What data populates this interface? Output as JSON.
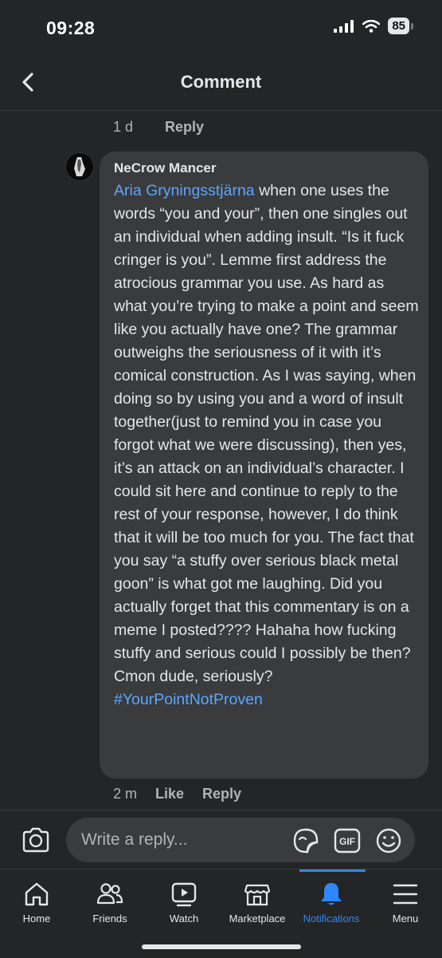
{
  "status_bar": {
    "time": "09:28",
    "battery": "85"
  },
  "header": {
    "title": "Comment"
  },
  "previous_comment": {
    "time": "1 d",
    "reply_label": "Reply"
  },
  "comment": {
    "author": "NeCrow Mancer",
    "mention": "Aria Gryningsstjärna",
    "body": " when one uses the words “you and your”, then one singles out an individual when adding insult. “Is it fuck cringer is you”. Lemme first address the atrocious grammar you use. As hard as what you’re trying to make a point and seem like you actually have one? The grammar outweighs the seriousness of it with it’s comical construction. As I was saying, when doing so by using you and a word of insult together(just to remind you in case you forgot what we were discussing), then yes, it’s an attack on an individual’s character. I could sit here and continue to reply to the rest of your response, however, I do think that it will be too much for you. The fact that you say “a stuffy over serious black metal goon” is what got me laughing. Did you actually forget that this commentary is on a meme I posted???? Hahaha how fucking stuffy and serious could I possibly be then? Cmon dude, seriously? ",
    "hashtag": "#YourPointNotProven",
    "time": "2 m",
    "like_label": "Like",
    "reply_label": "Reply"
  },
  "composer": {
    "placeholder": "Write a reply..."
  },
  "tabs": [
    {
      "label": "Home",
      "icon": "home-icon"
    },
    {
      "label": "Friends",
      "icon": "friends-icon"
    },
    {
      "label": "Watch",
      "icon": "watch-icon"
    },
    {
      "label": "Marketplace",
      "icon": "marketplace-icon"
    },
    {
      "label": "Notifications",
      "icon": "bell-icon",
      "active": true
    },
    {
      "label": "Menu",
      "icon": "menu-icon"
    }
  ],
  "colors": {
    "background": "#242526",
    "bubble": "#3a3b3c",
    "link": "#5aa7ff",
    "active_tab": "#2d88ff"
  }
}
